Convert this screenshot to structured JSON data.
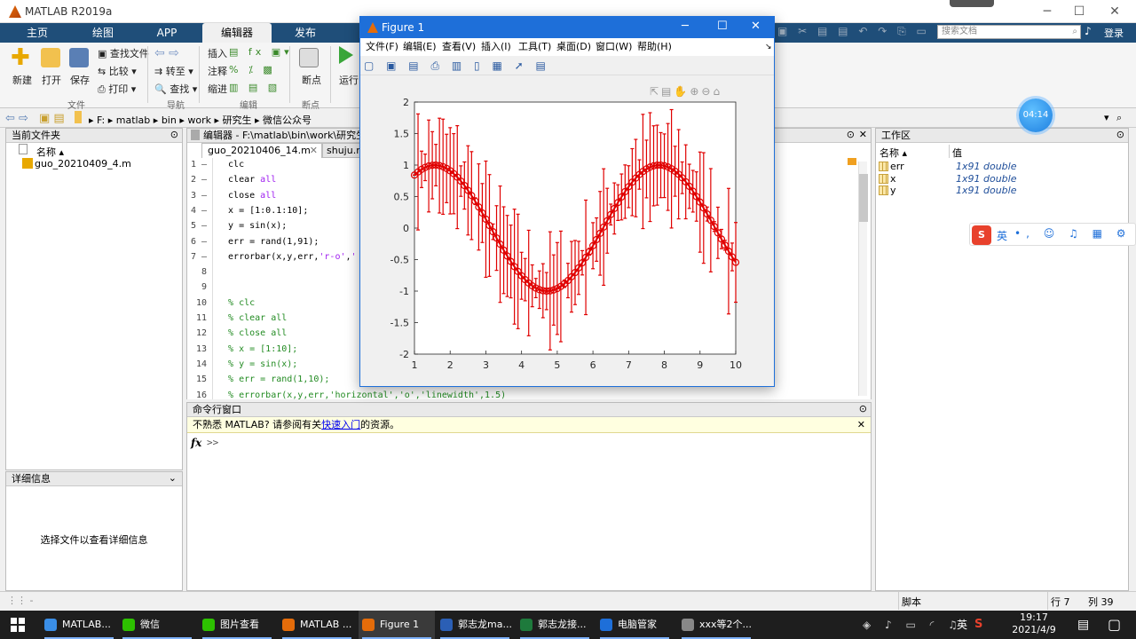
{
  "window": {
    "title": "MATLAB R2019a",
    "minimize": "─",
    "maximize": "☐",
    "close": "✕"
  },
  "ribbon_tabs": [
    "主页",
    "绘图",
    "APP",
    "编辑器",
    "发布"
  ],
  "ribbon": {
    "new": "新建",
    "open": "打开",
    "save": "保存",
    "find_files": "查找文件",
    "compare": "比较",
    "print": "打印",
    "goto": "转至",
    "find": "查找",
    "insert": "插入",
    "comment": "注释",
    "indent": "缩进",
    "breakpoints": "断点",
    "run": "运行",
    "group_file": "文件",
    "group_nav": "导航",
    "group_edit": "编辑",
    "group_bp": "断点"
  },
  "toolbar_right": {
    "search_placeholder": "搜索文档",
    "login": "登录"
  },
  "address": {
    "path": [
      "F:",
      "matlab",
      "bin",
      "work",
      "研究生",
      "微信公众号"
    ]
  },
  "current_folder": {
    "title": "当前文件夹",
    "column": "名称 ▴",
    "files": [
      "guo_20210409_4.m"
    ]
  },
  "details": {
    "title": "详细信息",
    "message": "选择文件以查看详细信息"
  },
  "editor": {
    "title": "编辑器 - F:\\matlab\\bin\\work\\研究生\\微",
    "tabs": [
      "guo_20210406_14.m",
      "shuju.m"
    ],
    "lines": [
      {
        "n": "1 —",
        "code": "  clc",
        "cls": ""
      },
      {
        "n": "2 —",
        "code": "  clear all",
        "cls": "mix1"
      },
      {
        "n": "3 —",
        "code": "  close all",
        "cls": "mix1"
      },
      {
        "n": "4 —",
        "code": "  x = [1:0.1:10];",
        "cls": ""
      },
      {
        "n": "5 —",
        "code": "  y = sin(x);",
        "cls": ""
      },
      {
        "n": "6 —",
        "code": "  err = rand(1,91);",
        "cls": ""
      },
      {
        "n": "7 —",
        "code": "  errorbar(x,y,err,'r-o','",
        "cls": "mix2"
      },
      {
        "n": "8",
        "code": "",
        "cls": ""
      },
      {
        "n": "9",
        "code": "",
        "cls": ""
      },
      {
        "n": "10",
        "code": "  % clc",
        "cls": "cm"
      },
      {
        "n": "11",
        "code": "  % clear all",
        "cls": "cm"
      },
      {
        "n": "12",
        "code": "  % close all",
        "cls": "cm"
      },
      {
        "n": "13",
        "code": "  % x = [1:10];",
        "cls": "cm"
      },
      {
        "n": "14",
        "code": "  % y = sin(x);",
        "cls": "cm"
      },
      {
        "n": "15",
        "code": "  % err = rand(1,10);",
        "cls": "cm"
      },
      {
        "n": "16",
        "code": "  % errorbar(x,y,err,'horizontal','o','linewidth',1.5)",
        "cls": "cm"
      }
    ]
  },
  "command_window": {
    "title": "命令行窗口",
    "notice_pre": "不熟悉 MATLAB? 请参阅有关",
    "notice_link": "快速入门",
    "notice_post": "的资源。",
    "prompt": ">>"
  },
  "workspace": {
    "title": "工作区",
    "col_name": "名称 ▴",
    "col_value": "值",
    "vars": [
      {
        "name": "err",
        "value": "1x91 double"
      },
      {
        "name": "x",
        "value": "1x91 double"
      },
      {
        "name": "y",
        "value": "1x91 double"
      }
    ]
  },
  "timer": "04:14",
  "ime": {
    "lang": "英"
  },
  "statusbar": {
    "mode": "脚本",
    "row": "行  7",
    "col": "列  39"
  },
  "figure": {
    "title": "Figure 1",
    "menu": [
      "文件(F)",
      "编辑(E)",
      "查看(V)",
      "插入(I)",
      "工具(T)",
      "桌面(D)",
      "窗口(W)",
      "帮助(H)"
    ]
  },
  "chart_data": {
    "type": "line",
    "title": "",
    "xlabel": "",
    "ylabel": "",
    "xlim": [
      1,
      10
    ],
    "ylim": [
      -2,
      2
    ],
    "xticks": [
      1,
      2,
      3,
      4,
      5,
      6,
      7,
      8,
      9,
      10
    ],
    "yticks": [
      -2,
      -1.5,
      -1,
      -0.5,
      0,
      0.5,
      1,
      1.5,
      2
    ],
    "series": [
      {
        "function": "sin(x)",
        "x_start": 1,
        "x_end": 10,
        "x_step": 0.1,
        "marker": "o",
        "color": "#e00000",
        "error": "rand(1,91)"
      }
    ]
  },
  "taskbar": {
    "items": [
      "MATLAB...",
      "微信",
      "图片查看",
      "MATLAB ...",
      "Figure 1",
      "郭志龙ma...",
      "郭志龙接...",
      "电脑管家",
      "xxx等2个..."
    ],
    "lang": "英",
    "time": "19:17",
    "date": "2021/4/9"
  }
}
